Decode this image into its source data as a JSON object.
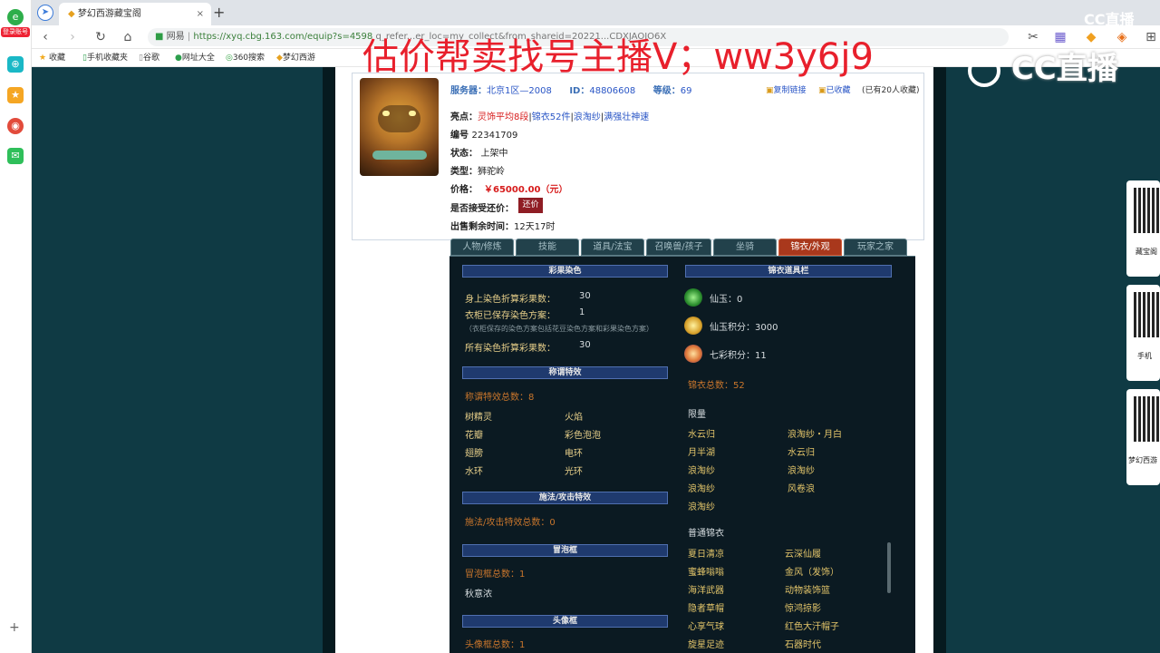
{
  "browser": {
    "tabs": [
      {
        "label": "梦幻西游藏宝阁",
        "close": "×"
      }
    ],
    "new_tab": "+",
    "url_prefix": "网易",
    "url": "https://xyq.cbg.163.com/equip?s=4598",
    "url_tail": "q_refer...er_loc=my_collect&from_shareid=20221...CDXJAOJO6X",
    "bookmarks": [
      "收藏",
      "手机收藏夹",
      "谷歌",
      "网址大全",
      "360搜索",
      "梦幻西游"
    ],
    "login_badge": "登录账号"
  },
  "overlay": {
    "text": "估价帮卖找号主播V；ww3y6j9",
    "logo": "CC直播",
    "top_logo": "CC直播"
  },
  "info": {
    "server_label": "服务器：",
    "server": "北京1区—2008",
    "id_label": "ID：",
    "id": "48806608",
    "level_label": "等级：",
    "level": "69",
    "copy_link": "复制链接",
    "collected": "已收藏",
    "collect_count": "(已有20人收藏)",
    "highlight_label": "亮点：",
    "highlights": [
      "灵饰平均8段",
      "锦衣52件",
      "浪淘纱",
      "满强壮神速"
    ],
    "number_label": "编号",
    "number": "22341709",
    "status_label": "状态：",
    "status": "上架中",
    "type_label": "类型：",
    "type": "狮驼岭",
    "price_label": "价格：",
    "price": "￥65000.00（元）",
    "bargain_label": "是否接受还价：",
    "bargain_button": "还价",
    "time_label": "出售剩余时间：",
    "time": "12天17时"
  },
  "tabs": [
    "人物/修炼",
    "技能",
    "道具/法宝",
    "召唤兽/孩子",
    "坐骑",
    "锦衣/外观",
    "玩家之家"
  ],
  "active_tab": "锦衣/外观",
  "left": {
    "dye_header": "彩果染色",
    "dye_rows": [
      {
        "label": "身上染色折算彩果数：",
        "value": "30"
      },
      {
        "label": "衣柜已保存染色方案：",
        "value": "1"
      }
    ],
    "dye_note": "（衣柜保存的染色方案包括花豆染色方案和彩果染色方案）",
    "dye_total": {
      "label": "所有染色折算彩果数：",
      "value": "30"
    },
    "title_header": "称谓特效",
    "title_count": "称谓特效总数：8",
    "title_items": [
      "树精灵",
      "火焰",
      "花瓣",
      "彩色泡泡",
      "翅膀",
      "电环",
      "水环",
      "光环"
    ],
    "spell_header": "施法/攻击特效",
    "spell_count": "施法/攻击特效总数：0",
    "bubble_header": "冒泡框",
    "bubble_count": "冒泡框总数：1",
    "bubble_items": [
      "秋意浓"
    ],
    "avatar_header": "头像框",
    "avatar_count": "头像框总数：1"
  },
  "right": {
    "bar_header": "锦衣道具栏",
    "currencies": [
      {
        "label": "仙玉：0"
      },
      {
        "label": "仙玉积分：3000"
      },
      {
        "label": "七彩积分：11"
      }
    ],
    "jinyi_total": "锦衣总数：52",
    "limited_header": "限量",
    "limited_items": [
      "水云归",
      "浪淘纱・月白",
      "月半湖",
      "水云归",
      "浪淘纱",
      "浪淘纱",
      "浪淘纱",
      "风卷浪",
      "浪淘纱"
    ],
    "normal_header": "普通锦衣",
    "normal_items": [
      "夏日清凉",
      "云深仙履",
      "蜜蜂嗡嗡",
      "金风（发饰）",
      "海洋武器",
      "动物装饰篮",
      "隐者草帽",
      "惊鸿掠影",
      "心享气球",
      "红色大汗帽子",
      "旋星足迹",
      "石器时代"
    ]
  },
  "qr_labels": [
    "藏宝阁",
    "手机",
    "梦幻西游"
  ]
}
